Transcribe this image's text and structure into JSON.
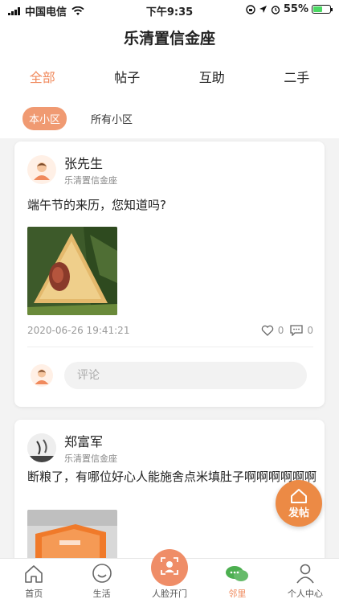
{
  "status_bar": {
    "carrier": "中国电信",
    "time": "下午9:35",
    "battery": "55%"
  },
  "header": {
    "title": "乐清置信金座"
  },
  "tabs": [
    {
      "label": "全部",
      "active": true
    },
    {
      "label": "帖子",
      "active": false
    },
    {
      "label": "互助",
      "active": false
    },
    {
      "label": "二手",
      "active": false
    }
  ],
  "filters": [
    {
      "label": "本小区",
      "active": true
    },
    {
      "label": "所有小区",
      "active": false
    }
  ],
  "posts": [
    {
      "author": "张先生",
      "community": "乐清置信金座",
      "text": "端午节的来历，您知道吗?",
      "timestamp": "2020-06-26 19:41:21",
      "likes": "0",
      "comments": "0",
      "comment_placeholder": "评论"
    },
    {
      "author": "郑富军",
      "community": "乐清置信金座",
      "text": "断粮了，有哪位好心人能施舍点米填肚子啊啊啊啊啊啊"
    }
  ],
  "fab": {
    "label": "发帖"
  },
  "tabbar": [
    {
      "label": "首页",
      "icon": "home-icon"
    },
    {
      "label": "生活",
      "icon": "smile-icon"
    },
    {
      "label": "人脸开门",
      "icon": "face-icon"
    },
    {
      "label": "邻里",
      "icon": "chat-icon",
      "active": true
    },
    {
      "label": "个人中心",
      "icon": "person-icon"
    }
  ],
  "colors": {
    "accent": "#f08a5d",
    "fab": "#ec8a45",
    "neighbor_green": "#4caf50"
  }
}
